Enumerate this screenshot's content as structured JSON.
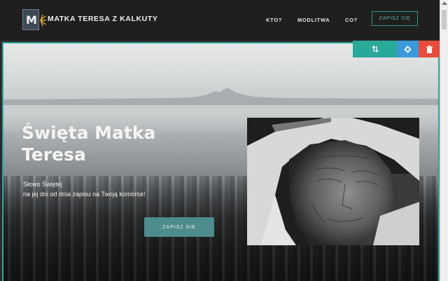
{
  "navbar": {
    "logo_letter": "M",
    "brand": "MATKA TERESA Z KALKUTY",
    "items": [
      {
        "label": "KTO?"
      },
      {
        "label": "MODLITWA"
      },
      {
        "label": "CO?"
      }
    ],
    "cta": "ZAPISZ SIĘ"
  },
  "hero": {
    "title_line1": "Święta Matka",
    "title_line2": "Teresa",
    "subtitle_line1": "Słowo Świętej",
    "subtitle_line2": "na jej dni od dnia zapisu na Twoją komórce!",
    "cta": "ZAPISZ SIĘ"
  },
  "controls": [
    {
      "name": "move",
      "icon": "move-icon"
    },
    {
      "name": "settings",
      "icon": "gear-icon"
    },
    {
      "name": "delete",
      "icon": "trash-icon"
    }
  ],
  "colors": {
    "accent": "#2ca89c",
    "navbar": "#1f1f1f",
    "settings": "#3c99db",
    "delete": "#e74c3c",
    "cta": "#4e8b8c"
  }
}
